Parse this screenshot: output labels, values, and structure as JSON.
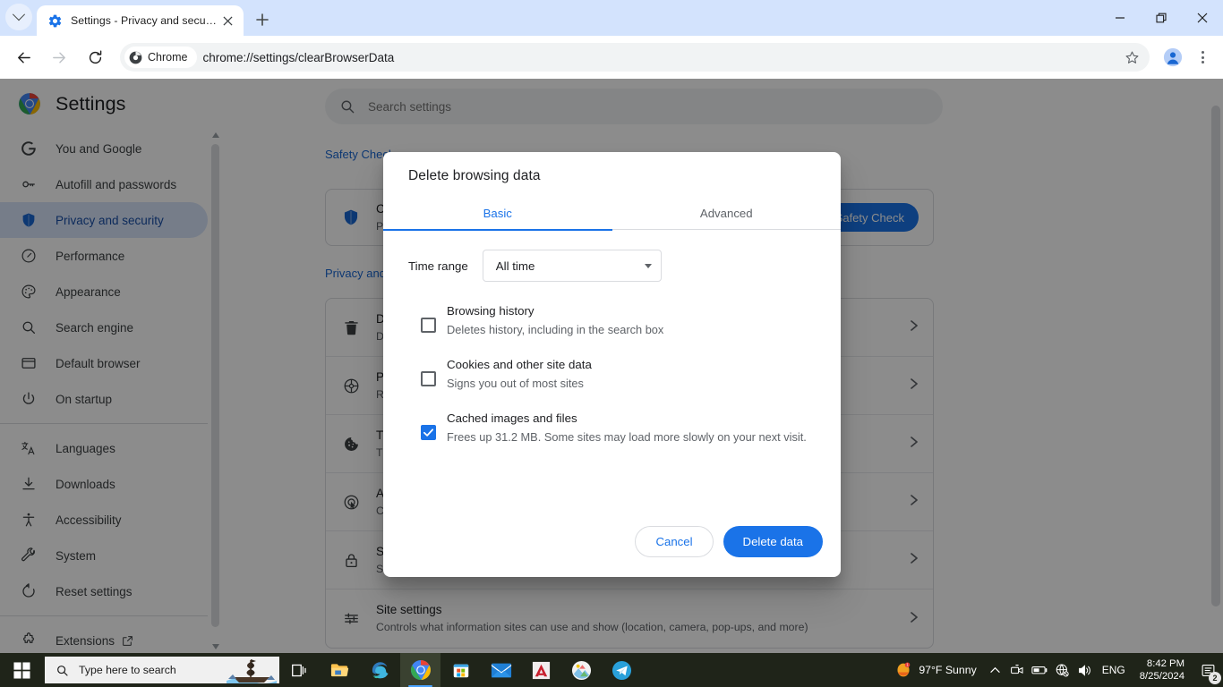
{
  "browser": {
    "tab": {
      "title": "Settings - Privacy and security",
      "favicon": "settings-gear-icon",
      "close_icon": "close-icon",
      "tab_search_icon": "chevron-down-icon",
      "new_tab_icon": "plus-icon"
    },
    "window_controls": {
      "minimize": "minimize-icon",
      "maximize": "restore-icon",
      "close": "close-icon"
    },
    "toolbar": {
      "back_icon": "arrow-left-icon",
      "forward_icon": "arrow-right-icon",
      "reload_icon": "reload-icon",
      "chip_label": "Chrome",
      "chip_icon": "chrome-logo-icon",
      "url": "chrome://settings/clearBrowserData",
      "bookmark_icon": "star-icon",
      "profile_icon": "profile-avatar-icon",
      "menu_icon": "kebab-menu-icon"
    }
  },
  "settings": {
    "title": "Settings",
    "logo_icon": "chrome-logo-icon",
    "search": {
      "placeholder": "Search settings",
      "value": "",
      "icon": "search-icon"
    },
    "nav_items": [
      {
        "label": "You and Google",
        "icon": "google-g-icon",
        "selected": false
      },
      {
        "label": "Autofill and passwords",
        "icon": "key-icon",
        "selected": false
      },
      {
        "label": "Privacy and security",
        "icon": "shield-icon",
        "selected": true
      },
      {
        "label": "Performance",
        "icon": "speedometer-icon",
        "selected": false
      },
      {
        "label": "Appearance",
        "icon": "palette-icon",
        "selected": false
      },
      {
        "label": "Search engine",
        "icon": "search-icon",
        "selected": false
      },
      {
        "label": "Default browser",
        "icon": "browser-window-icon",
        "selected": false
      },
      {
        "label": "On startup",
        "icon": "power-icon",
        "selected": false
      }
    ],
    "nav_items_2": [
      {
        "label": "Languages",
        "icon": "translate-icon"
      },
      {
        "label": "Downloads",
        "icon": "download-icon"
      },
      {
        "label": "Accessibility",
        "icon": "accessibility-icon"
      },
      {
        "label": "System",
        "icon": "wrench-icon"
      },
      {
        "label": "Reset settings",
        "icon": "restore-refresh-icon"
      }
    ],
    "nav_items_3": [
      {
        "label": "Extensions",
        "icon": "puzzle-piece-icon",
        "external_icon": "open-in-new-icon"
      }
    ],
    "safety_check": {
      "heading": "Safety Check",
      "row_title": "Chrome can help keep you safe from data breaches, bad extensions, and more",
      "row_sub": "Passwords, extensions, updates, and Safe Browsing",
      "icon": "shield-icon",
      "button_label": "Safety Check"
    },
    "privacy_section": {
      "heading": "Privacy and security",
      "rows": [
        {
          "title": "Delete browsing data",
          "sub": "Delete history, cookies, cache, and more",
          "icon": "trash-icon"
        },
        {
          "title": "Privacy Guide",
          "sub": "Review key privacy and security controls",
          "icon": "privacy-guide-icon"
        },
        {
          "title": "Third-party cookies",
          "sub": "Third-party cookies are blocked in Incognito mode",
          "icon": "cookie-icon"
        },
        {
          "title": "Ad privacy",
          "sub": "Customize the info used by sites to show you ads",
          "icon": "ad-privacy-icon"
        },
        {
          "title": "Security",
          "sub": "Safe Browsing (protection from dangerous sites) and other security settings",
          "icon": "lock-icon"
        },
        {
          "title": "Site settings",
          "sub": "Controls what information sites can use and show (location, camera, pop-ups, and more)",
          "icon": "sliders-icon"
        }
      ],
      "row_arrow_icon": "chevron-right-icon"
    }
  },
  "dialog": {
    "title": "Delete browsing data",
    "tabs": [
      {
        "label": "Basic",
        "active": true
      },
      {
        "label": "Advanced",
        "active": false
      }
    ],
    "time_range": {
      "label": "Time range",
      "value": "All time",
      "dropdown_icon": "triangle-down-icon"
    },
    "options": [
      {
        "title": "Browsing history",
        "sub": "Deletes history, including in the search box",
        "checked": false
      },
      {
        "title": "Cookies and other site data",
        "sub": "Signs you out of most sites",
        "checked": false
      },
      {
        "title": "Cached images and files",
        "sub": "Frees up 31.2 MB. Some sites may load more slowly on your next visit.",
        "checked": true
      }
    ],
    "cancel_label": "Cancel",
    "confirm_label": "Delete data"
  },
  "taskbar": {
    "start_icon": "windows-start-icon",
    "search": {
      "placeholder": "Type here to search",
      "icon": "search-icon",
      "decoration_icon": "pirate-ship-icon"
    },
    "apps": [
      {
        "name": "task-view-icon",
        "active": false
      },
      {
        "name": "file-explorer-icon",
        "active": false
      },
      {
        "name": "microsoft-edge-icon",
        "active": false
      },
      {
        "name": "google-chrome-icon",
        "active": true
      },
      {
        "name": "microsoft-store-icon",
        "active": false
      },
      {
        "name": "mail-icon",
        "active": false
      },
      {
        "name": "autocad-icon",
        "active": false
      },
      {
        "name": "photos-icon",
        "active": false
      },
      {
        "name": "telegram-icon",
        "active": false
      }
    ],
    "weather": {
      "temperature": "97°F",
      "condition": "Sunny",
      "icon": "sun-icon"
    },
    "tray": {
      "overflow_icon": "chevron-up-icon",
      "camera_icon": "camera-icon",
      "battery_icon": "battery-icon",
      "network_icon": "network-globe-off-icon",
      "volume_icon": "speaker-icon",
      "language": "ENG"
    },
    "clock": {
      "time": "8:42 PM",
      "date": "8/25/2024"
    },
    "notifications": {
      "icon": "notification-icon",
      "count": "2"
    }
  },
  "colors": {
    "accent_blue": "#1a73e8",
    "tab_strip": "#d3e3fd",
    "selected_nav": "#d7e3fa",
    "selected_nav_text": "#174ea6",
    "taskbar": "#1f2419"
  }
}
